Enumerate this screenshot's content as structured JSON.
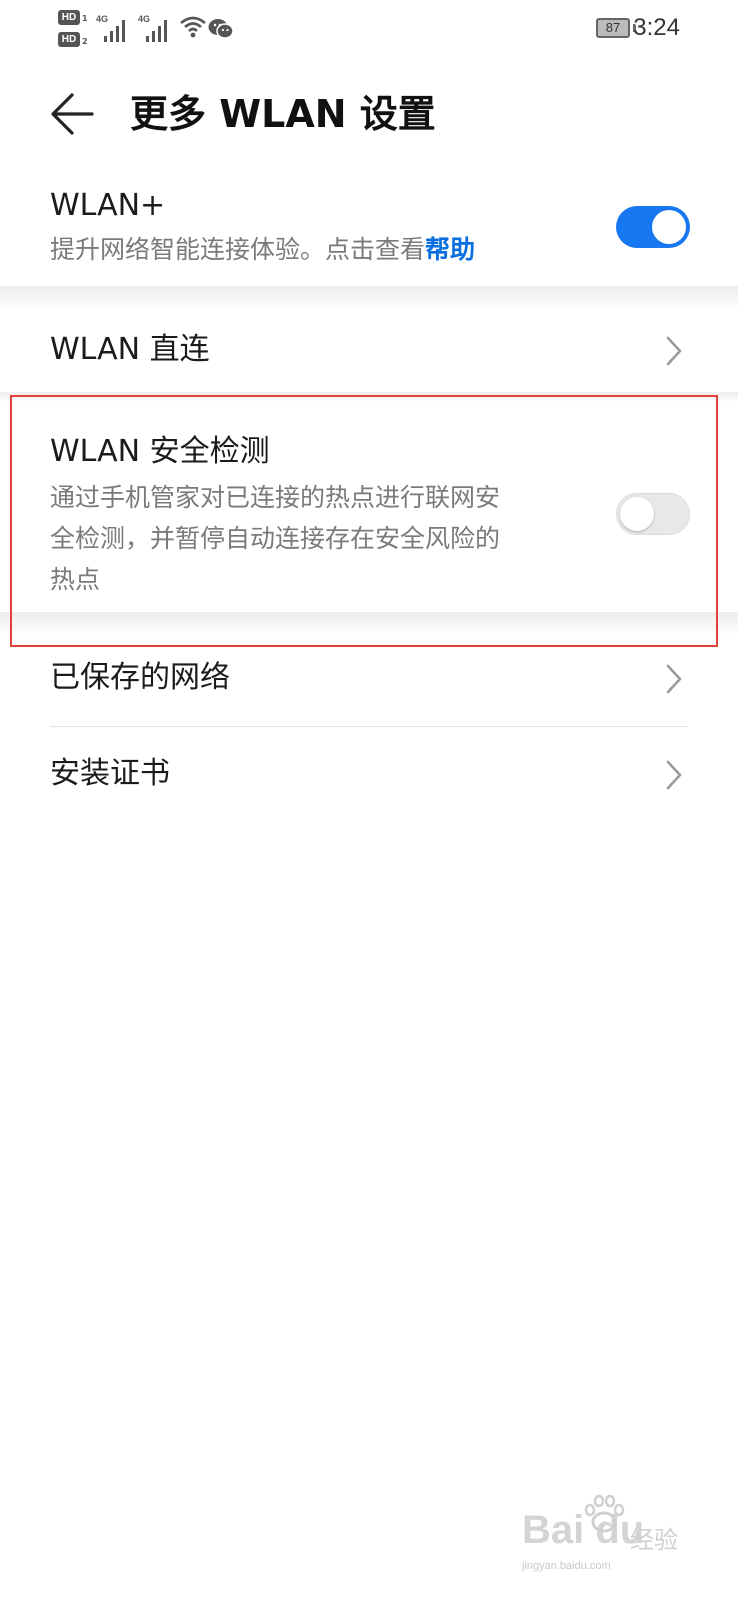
{
  "status_bar": {
    "hd1_label": "HD",
    "hd1_num": "1",
    "hd2_label": "HD",
    "hd2_num": "2",
    "sim1_network": "4G",
    "sim2_network": "4G",
    "battery_level": "87",
    "time": "3:24",
    "icons": [
      "signal-icon",
      "wifi-icon",
      "wechat-icon",
      "battery-icon"
    ]
  },
  "header": {
    "back_icon": "back-arrow-icon",
    "title": "更多 WLAN 设置"
  },
  "settings": {
    "wlan_plus": {
      "title": "WLAN+",
      "subtitle": "提升网络智能连接体验。点击查看",
      "link_text": "帮助",
      "toggle_on": true
    },
    "wlan_direct": {
      "title": "WLAN 直连"
    },
    "wlan_security": {
      "title": "WLAN 安全检测",
      "subtitle_line1": "通过手机管家对已连接的热点进行联网安",
      "subtitle_line2": "全检测，并暂停自动连接存在安全风险的",
      "subtitle_line3": "热点",
      "toggle_on": false
    },
    "saved_networks": {
      "title": "已保存的网络"
    },
    "install_cert": {
      "title": "安装证书"
    }
  },
  "colors": {
    "accent": "#1677f0",
    "link": "#0a6fe0",
    "highlight_border": "#e0413a",
    "subtitle": "#7a7a7a"
  },
  "watermark": {
    "logo": "Bai du",
    "text": "经验",
    "url": "jingyan.baidu.com"
  }
}
